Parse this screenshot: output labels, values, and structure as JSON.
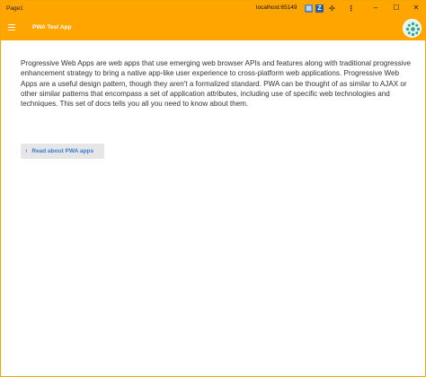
{
  "window": {
    "title": "Page1",
    "host": "localhost:65149",
    "controls": {
      "minimize": "–",
      "maximize": "☐",
      "close": "✕"
    }
  },
  "toolbar": {
    "extensions": [
      {
        "name": "grid-extension-icon",
        "glyph": "▦"
      },
      {
        "name": "z-extension-icon",
        "glyph": "Z"
      },
      {
        "name": "puzzle-icon",
        "glyph": "✣"
      },
      {
        "name": "more-icon",
        "glyph": "⋮"
      }
    ]
  },
  "appbar": {
    "title": "PWA Test App",
    "accent": "#ffa500",
    "menu_icon": "hamburger-icon",
    "logo_icon": "app-logo-icon"
  },
  "main": {
    "paragraph": "Progressive Web Apps are web apps that use emerging web browser APIs and features along with traditional progressive enhancement strategy to bring a native app-like user experience to cross-platform web applications. Progressive Web Apps are a useful design pattern, though they aren't a formalized standard. PWA can be thought of as similar to AJAX or other similar patterns that encompass a set of application attributes, including use of specific web technologies and techniques. This set of docs tells you all you need to know about them.",
    "read_button": {
      "chevron": "›",
      "label": "Read about PWA apps"
    }
  }
}
